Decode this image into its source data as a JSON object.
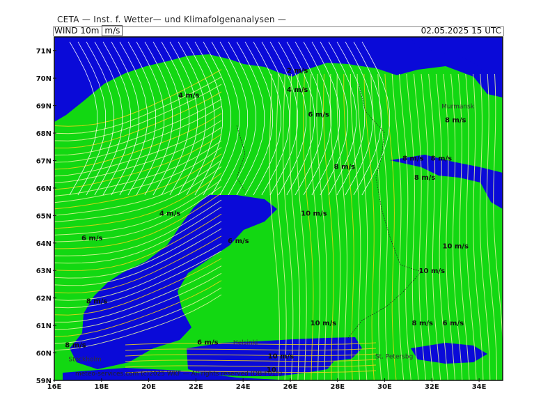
{
  "header": {
    "title": "CETA — Inst. f. Wetter— und Klimafolgenanalysen —",
    "field": "WIND  10m",
    "unit": "m/s",
    "valid_time": "02.05.2025  15 UTC"
  },
  "axes": {
    "lat_ticks": [
      "71N",
      "70N",
      "69N",
      "68N",
      "67N",
      "66N",
      "65N",
      "64N",
      "63N",
      "62N",
      "61N",
      "60N",
      "59N"
    ],
    "lon_ticks": [
      "16E",
      "18E",
      "20E",
      "22E",
      "24E",
      "26E",
      "28E",
      "30E",
      "32E",
      "34E"
    ]
  },
  "colors": {
    "calm_blue": "#0a0ad8",
    "moderate_green": "#12d812",
    "streamline_light": "#eaf7a0",
    "streamline_white": "#ffffff",
    "streamline_yellow": "#f5d21a"
  },
  "speed_labels": [
    {
      "text": "2 m/s",
      "lon": 26.3,
      "lat": 70.2
    },
    {
      "text": "4 m/s",
      "lon": 26.3,
      "lat": 69.5
    },
    {
      "text": "4 m/s",
      "lon": 21.7,
      "lat": 69.3
    },
    {
      "text": "6 m/s",
      "lon": 27.2,
      "lat": 68.6
    },
    {
      "text": "8 m/s",
      "lon": 33.0,
      "lat": 68.4
    },
    {
      "text": "8 m/s",
      "lon": 28.3,
      "lat": 66.7
    },
    {
      "text": "8 m/s",
      "lon": 31.2,
      "lat": 67.0
    },
    {
      "text": "8 m/s",
      "lon": 32.4,
      "lat": 67.0
    },
    {
      "text": "8 m/s",
      "lon": 31.7,
      "lat": 66.3
    },
    {
      "text": "4 m/s",
      "lon": 20.9,
      "lat": 65.0
    },
    {
      "text": "10 m/s",
      "lon": 27.0,
      "lat": 65.0
    },
    {
      "text": "6 m/s",
      "lon": 17.6,
      "lat": 64.1
    },
    {
      "text": "6 m/s",
      "lon": 23.8,
      "lat": 64.0
    },
    {
      "text": "10 m/s",
      "lon": 33.0,
      "lat": 63.8
    },
    {
      "text": "10 m/s",
      "lon": 32.0,
      "lat": 62.9
    },
    {
      "text": "10 m/s",
      "lon": 27.4,
      "lat": 61.0
    },
    {
      "text": "8 m/s",
      "lon": 31.6,
      "lat": 61.0
    },
    {
      "text": "6 m/s",
      "lon": 32.9,
      "lat": 61.0
    },
    {
      "text": "8 m/s",
      "lon": 17.8,
      "lat": 61.8
    },
    {
      "text": "8 m/s",
      "lon": 16.9,
      "lat": 60.2
    },
    {
      "text": "6 m/s",
      "lon": 22.5,
      "lat": 60.3
    },
    {
      "text": "10 m/s",
      "lon": 25.6,
      "lat": 59.8
    },
    {
      "text": "10",
      "lon": 25.2,
      "lat": 59.3
    }
  ],
  "cities": [
    {
      "name": "Murmansk",
      "lon": 33.1,
      "lat": 68.9
    },
    {
      "name": "Helsinki",
      "lon": 24.1,
      "lat": 60.3
    },
    {
      "name": "St. Petersbg",
      "lon": 30.4,
      "lat": 59.8
    },
    {
      "name": "Stockholm",
      "lon": 17.3,
      "lat": 59.7
    }
  ],
  "credit": "meteo-services.com (c)2025 WKF — All rights reserved (DB-F015)"
}
